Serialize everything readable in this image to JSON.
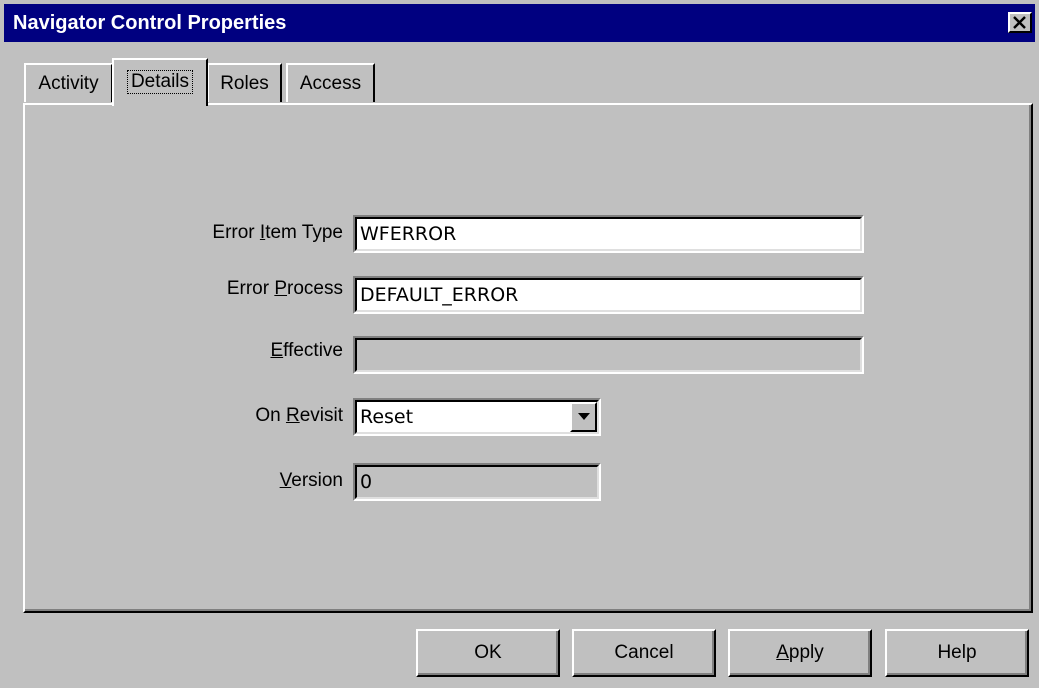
{
  "window": {
    "title": "Navigator Control Properties"
  },
  "tabs": [
    {
      "label": "Activity",
      "active": false
    },
    {
      "label": "Details",
      "active": true
    },
    {
      "label": "Roles",
      "active": false
    },
    {
      "label": "Access",
      "active": false
    }
  ],
  "form": {
    "error_item_type": {
      "label_pre": "Error ",
      "label_u": "I",
      "label_post": "tem Type",
      "value": "WFERROR"
    },
    "error_process": {
      "label_pre": "Error ",
      "label_u": "P",
      "label_post": "rocess",
      "value": "DEFAULT_ERROR"
    },
    "effective": {
      "label_pre": "",
      "label_u": "E",
      "label_post": "ffective",
      "value": ""
    },
    "on_revisit": {
      "label_pre": "On ",
      "label_u": "R",
      "label_post": "evisit",
      "value": "Reset"
    },
    "version": {
      "label_pre": "",
      "label_u": "V",
      "label_post": "ersion",
      "value": "0"
    }
  },
  "buttons": {
    "ok": "OK",
    "cancel": "Cancel",
    "apply_u": "A",
    "apply_rest": "pply",
    "help": "Help"
  },
  "colors": {
    "face": "#c0c0c0",
    "titlebar": "#000080"
  }
}
